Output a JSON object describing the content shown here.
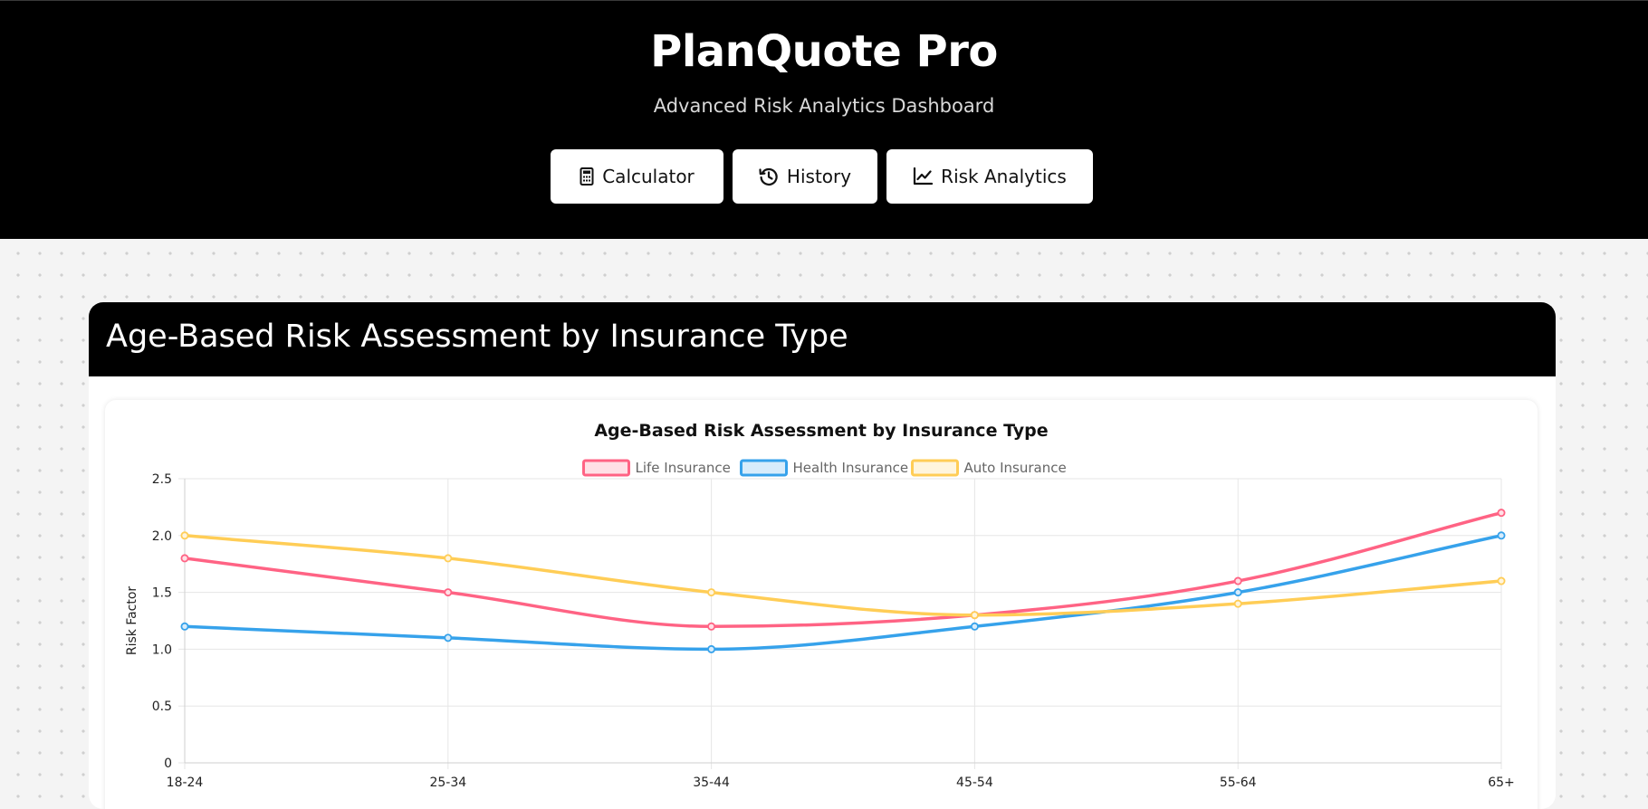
{
  "app": {
    "title": "PlanQuote Pro",
    "subtitle": "Advanced Risk Analytics Dashboard"
  },
  "nav": [
    {
      "label": "Calculator",
      "icon": "calculator-icon"
    },
    {
      "label": "History",
      "icon": "history-icon"
    },
    {
      "label": "Risk Analytics",
      "icon": "line-chart-icon"
    }
  ],
  "section": {
    "title": "Age-Based Risk Assessment by Insurance Type"
  },
  "chart_data": {
    "type": "line",
    "title": "Age-Based Risk Assessment by Insurance Type",
    "xlabel": "",
    "ylabel": "Risk Factor",
    "categories": [
      "18-24",
      "25-34",
      "35-44",
      "45-54",
      "55-64",
      "65+"
    ],
    "ylim": [
      0,
      2.5
    ],
    "yticks": [
      "0",
      "0.5",
      "1.0",
      "1.5",
      "2.0",
      "2.5"
    ],
    "grid": true,
    "legend_position": "top-center",
    "curve": "smooth",
    "series": [
      {
        "name": "Life Insurance",
        "color": "#ff6384",
        "fill": "#ffe0e6",
        "values": [
          1.8,
          1.5,
          1.2,
          1.3,
          1.6,
          2.2
        ]
      },
      {
        "name": "Health Insurance",
        "color": "#36a2eb",
        "fill": "#d7ecfb",
        "values": [
          1.2,
          1.1,
          1.0,
          1.2,
          1.5,
          2.0
        ]
      },
      {
        "name": "Auto Insurance",
        "color": "#ffcd56",
        "fill": "#fff5dd",
        "values": [
          2.0,
          1.8,
          1.5,
          1.3,
          1.4,
          1.6
        ]
      }
    ]
  }
}
